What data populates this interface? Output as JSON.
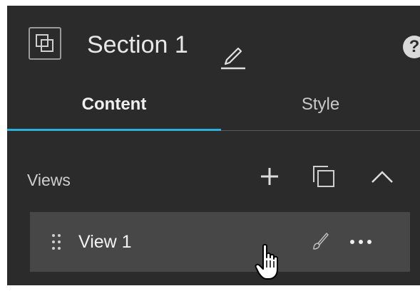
{
  "header": {
    "title": "Section 1",
    "icons": [
      "section-icon",
      "edit-pencil-icon",
      "help-icon"
    ],
    "help_glyph": "?"
  },
  "tabs": [
    {
      "label": "Content",
      "active": true
    },
    {
      "label": "Style",
      "active": false
    }
  ],
  "views": {
    "label": "Views",
    "actions": [
      "add-icon",
      "duplicate-icon",
      "collapse-icon"
    ],
    "items": [
      {
        "label": "View 1",
        "actions": [
          "brush-icon",
          "more-icon"
        ]
      }
    ]
  },
  "colors": {
    "panel_bg": "#2b2b2b",
    "row_bg": "#474747",
    "accent": "#2faddb"
  }
}
